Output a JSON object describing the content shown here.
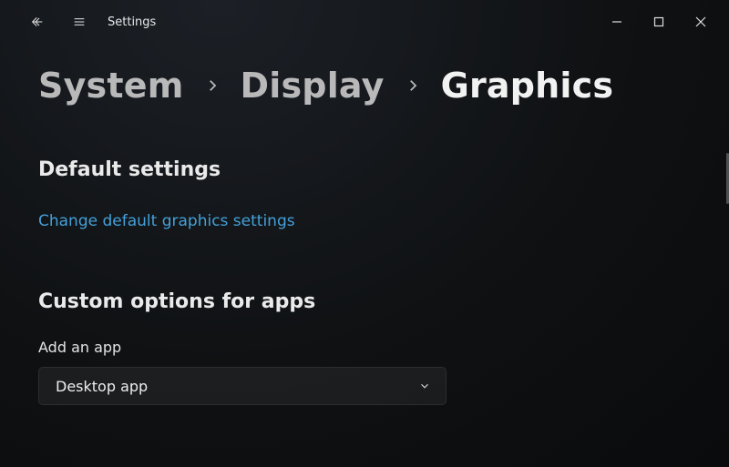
{
  "app_title": "Settings",
  "breadcrumb": {
    "system": "System",
    "display": "Display",
    "current": "Graphics"
  },
  "sections": {
    "default_settings_heading": "Default settings",
    "change_default_link": "Change default graphics settings",
    "custom_options_heading": "Custom options for apps",
    "add_app_label": "Add an app"
  },
  "dropdown": {
    "selected": "Desktop app"
  }
}
